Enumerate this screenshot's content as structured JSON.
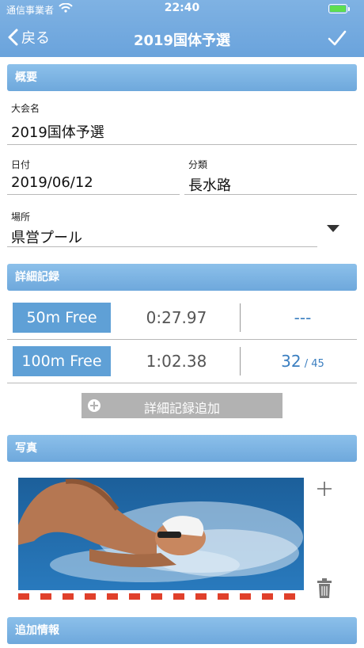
{
  "status_bar": {
    "carrier": "通信事業者",
    "time": "22:40"
  },
  "nav": {
    "back_label": "戻る",
    "title": "2019国体予選",
    "done_icon": "checkmark-icon"
  },
  "sections": {
    "overview": "概要",
    "details": "詳細記録",
    "photos": "写真",
    "extra": "追加情報"
  },
  "form": {
    "meet_label": "大会名",
    "meet_value": "2019国体予選",
    "date_label": "日付",
    "date_value": "2019/06/12",
    "category_label": "分類",
    "category_value": "長水路",
    "venue_label": "場所",
    "venue_value": "県営プール"
  },
  "records": [
    {
      "event": "50m Free",
      "time": "0:27.97",
      "rank": "---",
      "total": ""
    },
    {
      "event": "100m Free",
      "time": "1:02.38",
      "rank": "32",
      "total": " / 45"
    }
  ],
  "add_record_label": "詳細記録追加",
  "colors": {
    "header_blue": "#6ea8dc",
    "accent_blue": "#5fa0d6",
    "rank_blue": "#3a7ec0"
  }
}
